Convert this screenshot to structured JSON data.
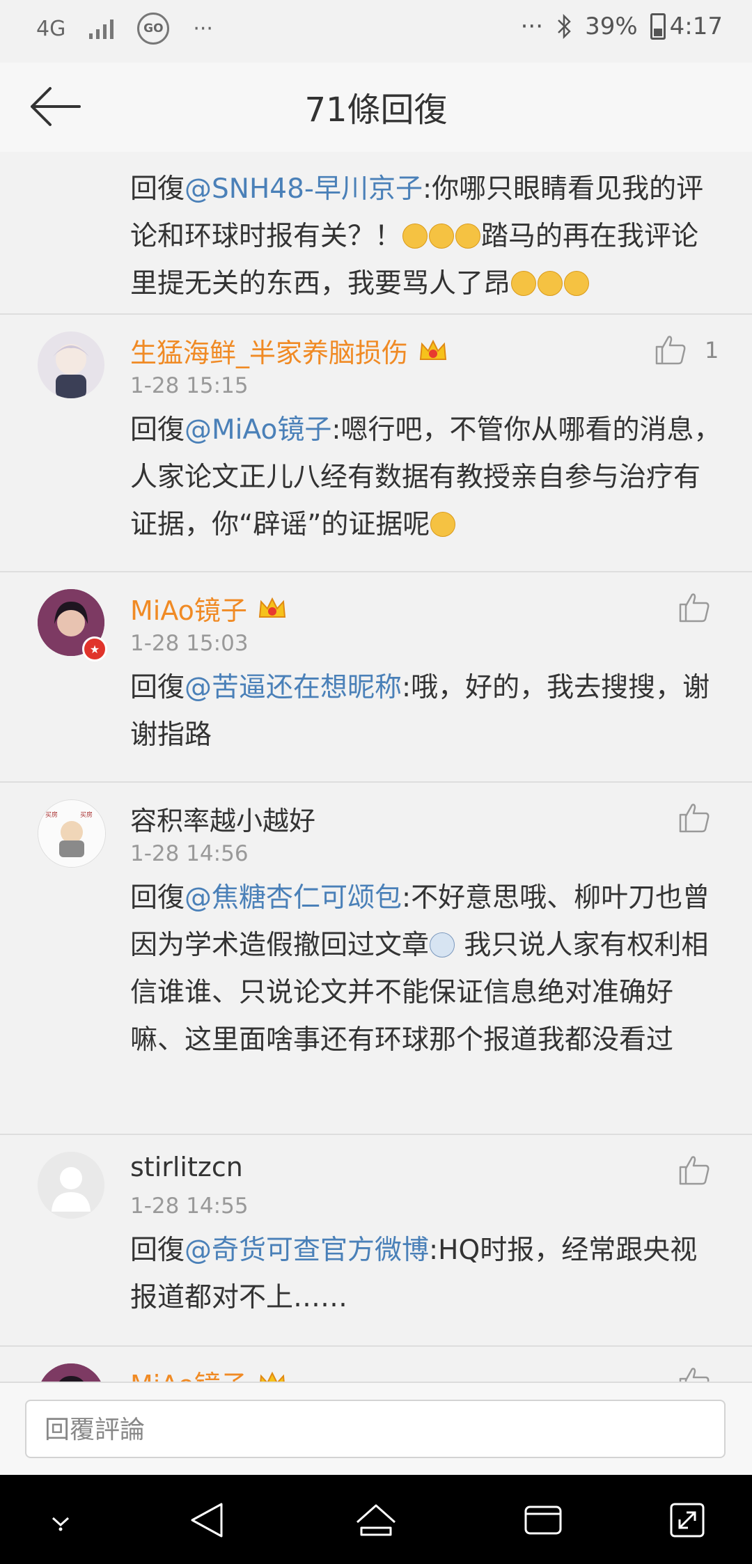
{
  "status": {
    "network": "4G",
    "go_label": "GO",
    "left_dots": "···",
    "right_dots": "···",
    "battery": "39%",
    "time": "4:17"
  },
  "header": {
    "title": "71條回復"
  },
  "comments": [
    {
      "reply_prefix": "回復",
      "mention": "@SNH48-早川京子",
      "text_a": ":你哪只眼睛看见我的评论和环球时报有关？！",
      "text_b": "踏马的再在我评论里提无关的东西，我要骂人了昂"
    },
    {
      "name": "生猛海鲜_半家养脑损伤",
      "time": "1-28 15:15",
      "likes": "1",
      "reply_prefix": "回復",
      "mention": "@MiAo镜子",
      "text": ":嗯行吧，不管你从哪看的消息，人家论文正儿八经有数据有教授亲自参与治疗有证据，你“辟谣”的证据呢"
    },
    {
      "name": "MiAo镜子",
      "time": "1-28 15:03",
      "reply_prefix": "回復",
      "mention": "@苦逼还在想昵称",
      "text": ":哦，好的，我去搜搜，谢谢指路"
    },
    {
      "name": "容积率越小越好",
      "time": "1-28 14:56",
      "reply_prefix": "回復",
      "mention": "@焦糖杏仁可颂包",
      "text_a": ":不好意思哦、柳叶刀也曾因为学术造假撤回过文章",
      "text_b": " 我只说人家有权利相信谁谁、只说论文并不能保证信息绝对准确好嘛、这里面啥事还有环球那个报道我都没看过"
    },
    {
      "name": "stirlitzcn",
      "time": "1-28 14:55",
      "reply_prefix": "回復",
      "mention": "@奇货可查官方微博",
      "text": ":HQ时报，经常跟央视报道都对不上……"
    },
    {
      "name": "MiAo镜子"
    }
  ],
  "input": {
    "placeholder": "回覆評論"
  },
  "colors": {
    "accent_orange": "#f08a24",
    "mention_blue": "#4a80b8"
  }
}
